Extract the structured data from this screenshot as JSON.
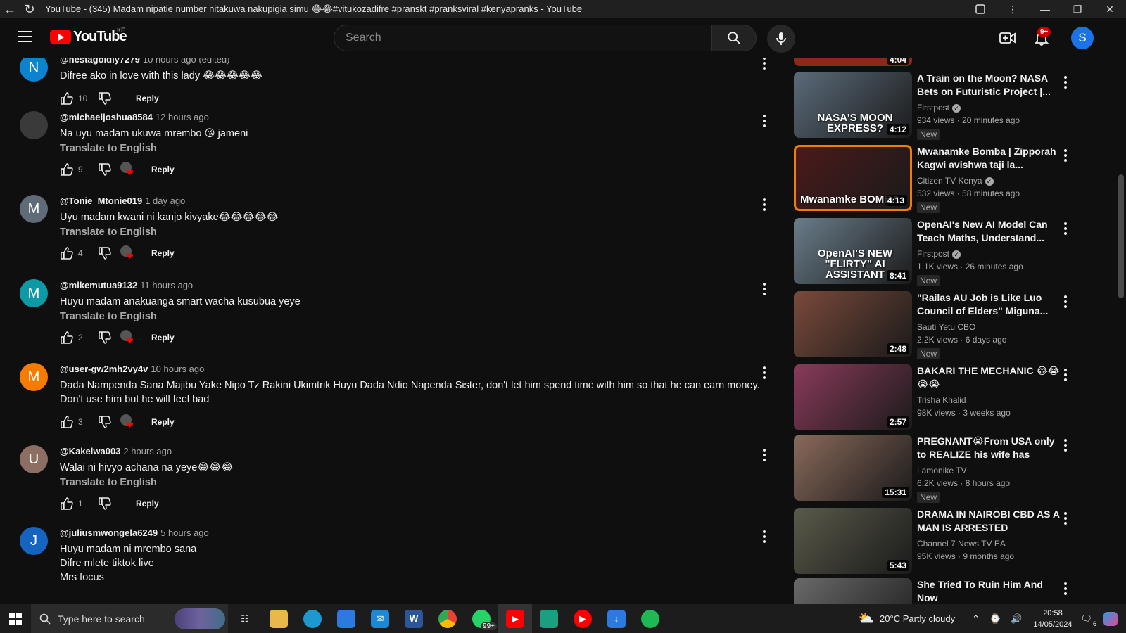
{
  "window": {
    "title": "YouTube - (345) Madam nipatie number nitakuwa nakupigia simu 😂😂#vitukozadifre #pranskt #pranksviral #kenyapranks - YouTube"
  },
  "masthead": {
    "logo_text": "YouTube",
    "country_code": "KE",
    "search_placeholder": "Search",
    "notifications_badge": "9+",
    "avatar_letter": "S"
  },
  "comments": [
    {
      "avatar_letter": "N",
      "avatar_color": "#0a83d0",
      "author": "@nestagoldly7279",
      "time": "10 hours ago (edited)",
      "text": "Difree ako in love with this lady   😂😂😂😂😂",
      "translate": "",
      "likes": "10",
      "reply": "Reply",
      "hearted": false
    },
    {
      "avatar_letter": "",
      "avatar_color": "#3a3a3a",
      "author": "@michaeljoshua8584",
      "time": "12 hours ago",
      "text": "Na uyu madam ukuwa mrembo 😘 jameni",
      "translate": "Translate to English",
      "likes": "9",
      "reply": "Reply",
      "hearted": true
    },
    {
      "avatar_letter": "M",
      "avatar_color": "#5f6b77",
      "author": "@Tonie_Mtonie019",
      "time": "1 day ago",
      "text": "Uyu madam kwani ni kanjo kivyake😂😂😂😂😂",
      "translate": "Translate to English",
      "likes": "4",
      "reply": "Reply",
      "hearted": true
    },
    {
      "avatar_letter": "M",
      "avatar_color": "#0d9aa5",
      "author": "@mikemutua9132",
      "time": "11 hours ago",
      "text": "Huyu madam anakuanga smart wacha kusubua yeye",
      "translate": "Translate to English",
      "likes": "2",
      "reply": "Reply",
      "hearted": true
    },
    {
      "avatar_letter": "M",
      "avatar_color": "#f57c00",
      "author": "@user-gw2mh2vy4v",
      "time": "10 hours ago",
      "text": "Dada Nampenda Sana Majibu Yake Nipo Tz Rakini Ukimtrik Huyu Dada Ndio Napenda Sister, don't let him spend time with him so that he can earn money. Don't use him but he will feel bad",
      "translate": "",
      "likes": "3",
      "reply": "Reply",
      "hearted": true
    },
    {
      "avatar_letter": "U",
      "avatar_color": "#8d6e63",
      "author": "@Kakelwa003",
      "time": "2 hours ago",
      "text": "Walai ni hivyo achana na yeye😂😂😂",
      "translate": "Translate to English",
      "likes": "1",
      "reply": "Reply",
      "hearted": false
    },
    {
      "avatar_letter": "J",
      "avatar_color": "#1565c0",
      "author": "@juliusmwongela6249",
      "time": "5 hours ago",
      "text": "Huyu madam ni mrembo sana\nDifre mlete tiktok live\nMrs focus",
      "translate": "",
      "likes": "",
      "reply": "",
      "hearted": false
    }
  ],
  "sidebar": {
    "partial_top_duration": "4:04",
    "videos": [
      {
        "title": "A Train on the Moon? NASA Bets on Futuristic Project |...",
        "channel": "Firstpost",
        "verified": true,
        "views": "934 views",
        "age": "20 minutes ago",
        "badge": "New",
        "duration": "4:12",
        "thumb_caption": "NASA'S MOON EXPRESS?",
        "thumb_bg": "#5b6b7a"
      },
      {
        "title": "Mwanamke Bomba | Zipporah Kagwi avishwa taji la...",
        "channel": "Citizen TV Kenya",
        "verified": true,
        "views": "532 views",
        "age": "58 minutes ago",
        "badge": "New",
        "duration": "4:13",
        "thumb_caption": "Mwanamke BOMBA",
        "thumb_bg": "#4a1a1a"
      },
      {
        "title": "OpenAI's New AI Model Can Teach Maths, Understand...",
        "channel": "Firstpost",
        "verified": true,
        "views": "1.1K views",
        "age": "26 minutes ago",
        "badge": "New",
        "duration": "8:41",
        "thumb_caption": "OpenAI'S NEW \"FLIRTY\" AI ASSISTANT",
        "thumb_bg": "#6a7d8a"
      },
      {
        "title": "\"Railas AU Job is Like Luo Council of Elders\" Miguna...",
        "channel": "Sauti Yetu CBO",
        "verified": false,
        "views": "2.2K views",
        "age": "6 days ago",
        "badge": "New",
        "duration": "2:48",
        "thumb_caption": "",
        "thumb_bg": "#7a4a3a"
      },
      {
        "title": "BAKARI THE MECHANIC 😂😭😭😭",
        "channel": "Trisha Khalid",
        "verified": false,
        "views": "98K views",
        "age": "3 weeks ago",
        "badge": "",
        "duration": "2:57",
        "thumb_caption": "",
        "thumb_bg": "#8a3a5a"
      },
      {
        "title": "PREGNANT😭From USA only to REALIZE his wife has been...",
        "channel": "Lamonike TV",
        "verified": false,
        "views": "6.2K views",
        "age": "8 hours ago",
        "badge": "New",
        "duration": "15:31",
        "thumb_caption": "",
        "thumb_bg": "#8a6a5a"
      },
      {
        "title": "DRAMA IN NAIROBI CBD AS A MAN IS ARRESTED",
        "channel": "Channel 7 News TV EA",
        "verified": false,
        "views": "95K views",
        "age": "9 months ago",
        "badge": "",
        "duration": "5:43",
        "thumb_caption": "",
        "thumb_bg": "#5a5a4a"
      },
      {
        "title": "She Tried To Ruin Him And Now",
        "channel": "",
        "verified": false,
        "views": "",
        "age": "",
        "badge": "",
        "duration": "",
        "thumb_caption": "",
        "thumb_bg": "#6a6a6a"
      }
    ]
  },
  "taskbar": {
    "search_placeholder": "Type here to search",
    "whatsapp_badge": "99+",
    "weather": "20°C  Partly cloudy",
    "time": "20:58",
    "date": "14/05/2024",
    "notification_count": "6"
  }
}
